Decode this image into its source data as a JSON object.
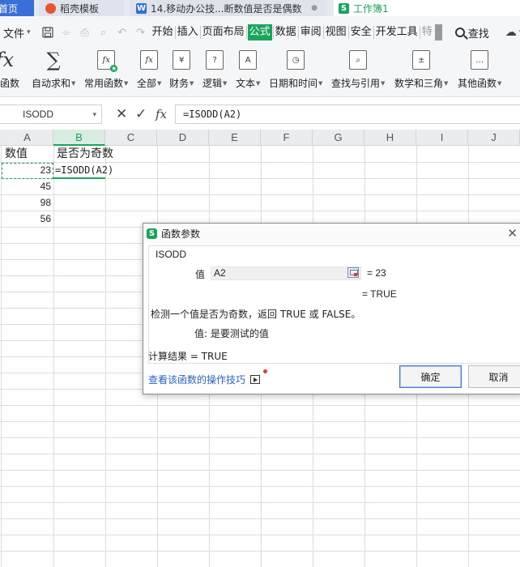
{
  "tabs": {
    "home": "首页",
    "daoke": "稻壳模板",
    "doc": "14.移动办公技...断数值是否是偶数",
    "doc_dot": "●",
    "workbook": "工作簿1"
  },
  "menubar": {
    "file": "文件",
    "items": [
      "开始",
      "插入",
      "页面布局",
      "公式",
      "数据",
      "审阅",
      "视图",
      "安全",
      "开发工具",
      "特"
    ],
    "active": "公式",
    "search": "查找"
  },
  "ribbon": {
    "items": [
      {
        "label": "入函数",
        "icon": "fx-insert-icon"
      },
      {
        "label": "自动求和",
        "icon": "sigma-icon"
      },
      {
        "label": "常用函数",
        "icon": "fx-common-icon"
      },
      {
        "label": "全部",
        "icon": "fx-all-icon"
      },
      {
        "label": "财务",
        "icon": "yen-icon"
      },
      {
        "label": "逻辑",
        "icon": "question-icon"
      },
      {
        "label": "文本",
        "icon": "text-a-icon"
      },
      {
        "label": "日期和时间",
        "icon": "clock-icon"
      },
      {
        "label": "查找与引用",
        "icon": "search-book-icon"
      },
      {
        "label": "数学和三角",
        "icon": "math-book-icon"
      },
      {
        "label": "其他函数",
        "icon": "more-book-icon"
      }
    ]
  },
  "formula_bar": {
    "name_box": "ISODD",
    "cancel": "✕",
    "confirm": "✓",
    "fx": "fx",
    "formula": "=ISODD(A2)"
  },
  "sheet": {
    "columns": [
      "A",
      "B",
      "C",
      "D",
      "E",
      "F",
      "G",
      "H",
      "I",
      "J"
    ],
    "selected_column": "B",
    "header_a": "数值",
    "header_b": "是否为奇数",
    "values": [
      "23",
      "45",
      "98",
      "56"
    ],
    "editing_formula": "=ISODD(A2)"
  },
  "dialog": {
    "title": "函数参数",
    "function_name": "ISODD",
    "arg_label": "值",
    "arg_value": "A2",
    "arg_evaluated": "= 23",
    "result_preview": "= TRUE",
    "description": "检测一个值是否为奇数，返回 TRUE 或 FALSE。",
    "arg_description": "值:  是要测试的值",
    "calc_result": "计算结果 = TRUE",
    "tips_link": "查看该函数的操作技巧",
    "ok": "确定",
    "cancel": "取消"
  }
}
